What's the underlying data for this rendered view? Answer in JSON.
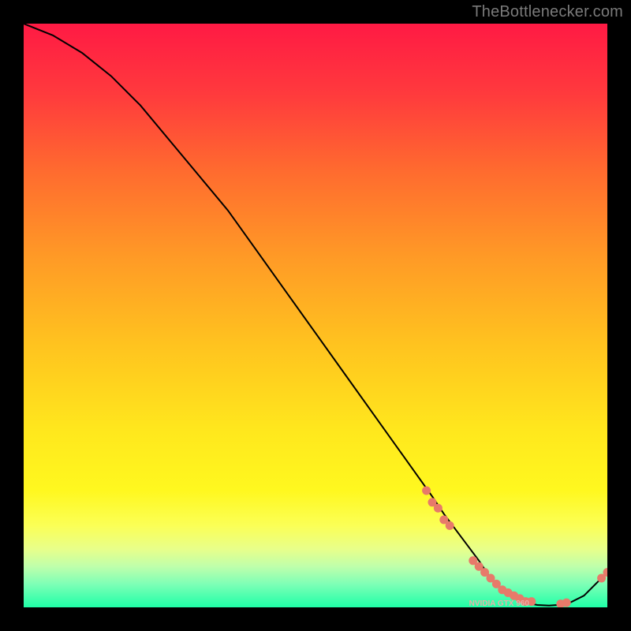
{
  "watermark": "TheBottlenecker.com",
  "small_series_label": "NVIDIA GTX 960",
  "chart_data": {
    "type": "line",
    "title": "",
    "xlabel": "",
    "ylabel": "",
    "xlim": [
      0,
      100
    ],
    "ylim": [
      0,
      100
    ],
    "series": [
      {
        "name": "bottleneck-curve",
        "x": [
          0,
          5,
          10,
          15,
          20,
          25,
          30,
          35,
          40,
          45,
          50,
          55,
          60,
          65,
          70,
          72,
          75,
          78,
          80,
          82,
          85,
          88,
          90,
          93,
          96,
          100
        ],
        "y": [
          100,
          98,
          95,
          91,
          86,
          80,
          74,
          68,
          61,
          54,
          47,
          40,
          33,
          26,
          19,
          16,
          12,
          8,
          5,
          3,
          1,
          0.4,
          0.3,
          0.5,
          2,
          6
        ]
      }
    ],
    "highlight_points": {
      "name": "gpu-match-markers",
      "x": [
        69,
        70,
        71,
        72,
        73,
        77,
        78,
        79,
        80,
        81,
        82,
        83,
        84,
        85,
        86,
        87,
        92,
        93,
        99,
        100
      ],
      "y": [
        20,
        18,
        17,
        15,
        14,
        8,
        7,
        6,
        5,
        4,
        3,
        2.5,
        2,
        1.5,
        1,
        1,
        0.6,
        0.8,
        5,
        6
      ]
    }
  }
}
